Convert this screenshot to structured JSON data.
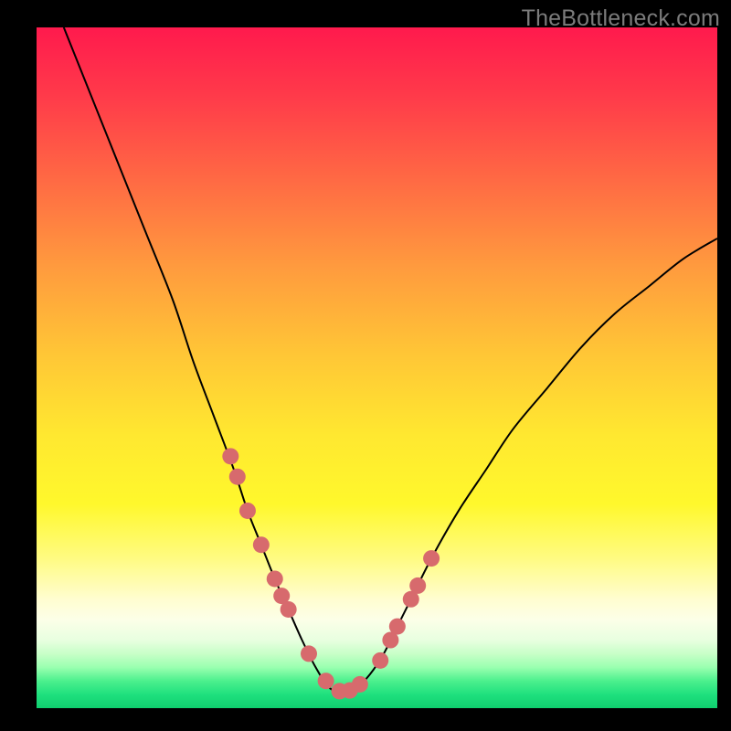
{
  "watermark": "TheBottleneck.com",
  "colors": {
    "dot": "#d76a6d",
    "curve": "#000000",
    "frame_bg_top": "#ff1a4d",
    "frame_bg_bottom": "#0fcf6e",
    "page_bg": "#000000",
    "watermark": "#7b7b7b"
  },
  "chart_data": {
    "type": "line",
    "title": "",
    "xlabel": "",
    "ylabel": "",
    "xlim": [
      0,
      100
    ],
    "ylim": [
      0,
      100
    ],
    "grid": false,
    "legend": false,
    "note": "Axis values are estimated from pixel positions; the image has no numeric tick labels. y represents bottleneck/mismatch percentage (low=green=good, high=red=bad). x is an unlabeled hardware-balance axis. Minimum (optimal point) is near x≈44.",
    "series": [
      {
        "name": "bottleneck-curve",
        "x": [
          4,
          8,
          12,
          16,
          20,
          23,
          26,
          29,
          31,
          33,
          35,
          37,
          39,
          41,
          43,
          45,
          47,
          49,
          51,
          53,
          55,
          58,
          62,
          66,
          70,
          75,
          80,
          85,
          90,
          95,
          100
        ],
        "y": [
          100,
          90,
          80,
          70,
          60,
          51,
          43,
          35,
          29,
          24,
          19,
          14.5,
          10,
          6,
          3,
          2.4,
          3,
          5,
          8,
          12,
          16,
          22,
          29,
          35,
          41,
          47,
          53,
          58,
          62,
          66,
          69
        ]
      }
    ],
    "marker_points": {
      "name": "highlighted-dots",
      "x": [
        28.5,
        29.5,
        31,
        33,
        35,
        36,
        37,
        40,
        42.5,
        44.5,
        46,
        47.5,
        50.5,
        52,
        53,
        55,
        56,
        58
      ],
      "y": [
        37,
        34,
        29,
        24,
        19,
        16.5,
        14.5,
        8,
        4,
        2.5,
        2.6,
        3.5,
        7,
        10,
        12,
        16,
        18,
        22
      ]
    }
  }
}
